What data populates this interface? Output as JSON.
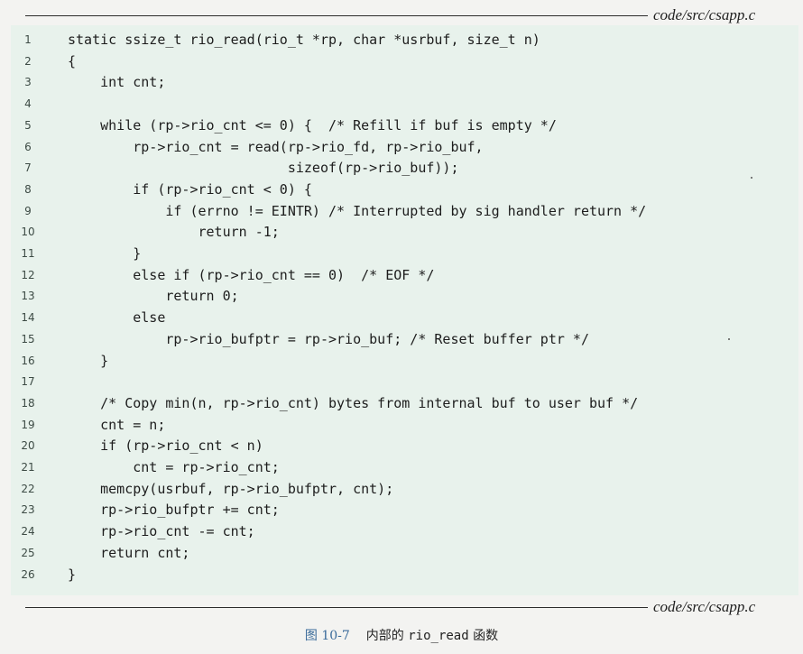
{
  "file_label_top": "code/src/csapp.c",
  "file_label_bottom": "code/src/csapp.c",
  "code_lines": [
    {
      "n": "1",
      "code": "static ssize_t rio_read(rio_t *rp, char *usrbuf, size_t n)"
    },
    {
      "n": "2",
      "code": "{"
    },
    {
      "n": "3",
      "code": "    int cnt;"
    },
    {
      "n": "4",
      "code": ""
    },
    {
      "n": "5",
      "code": "    while (rp->rio_cnt <= 0) {  /* Refill if buf is empty */"
    },
    {
      "n": "6",
      "code": "        rp->rio_cnt = read(rp->rio_fd, rp->rio_buf,"
    },
    {
      "n": "7",
      "code": "                           sizeof(rp->rio_buf));"
    },
    {
      "n": "8",
      "code": "        if (rp->rio_cnt < 0) {"
    },
    {
      "n": "9",
      "code": "            if (errno != EINTR) /* Interrupted by sig handler return */"
    },
    {
      "n": "10",
      "code": "                return -1;"
    },
    {
      "n": "11",
      "code": "        }"
    },
    {
      "n": "12",
      "code": "        else if (rp->rio_cnt == 0)  /* EOF */"
    },
    {
      "n": "13",
      "code": "            return 0;"
    },
    {
      "n": "14",
      "code": "        else"
    },
    {
      "n": "15",
      "code": "            rp->rio_bufptr = rp->rio_buf; /* Reset buffer ptr */"
    },
    {
      "n": "16",
      "code": "    }"
    },
    {
      "n": "17",
      "code": ""
    },
    {
      "n": "18",
      "code": "    /* Copy min(n, rp->rio_cnt) bytes from internal buf to user buf */"
    },
    {
      "n": "19",
      "code": "    cnt = n;"
    },
    {
      "n": "20",
      "code": "    if (rp->rio_cnt < n)"
    },
    {
      "n": "21",
      "code": "        cnt = rp->rio_cnt;"
    },
    {
      "n": "22",
      "code": "    memcpy(usrbuf, rp->rio_bufptr, cnt);"
    },
    {
      "n": "23",
      "code": "    rp->rio_bufptr += cnt;"
    },
    {
      "n": "24",
      "code": "    rp->rio_cnt -= cnt;"
    },
    {
      "n": "25",
      "code": "    return cnt;"
    },
    {
      "n": "26",
      "code": "}"
    }
  ],
  "caption": {
    "figure_number": "图 10-7",
    "text_before": "内部的 ",
    "code_name": "rio_read",
    "text_after": " 函数"
  },
  "colors": {
    "code_background": "#e8f2ec",
    "page_background": "#f3f3f1",
    "figure_number": "#3a6b9a"
  }
}
